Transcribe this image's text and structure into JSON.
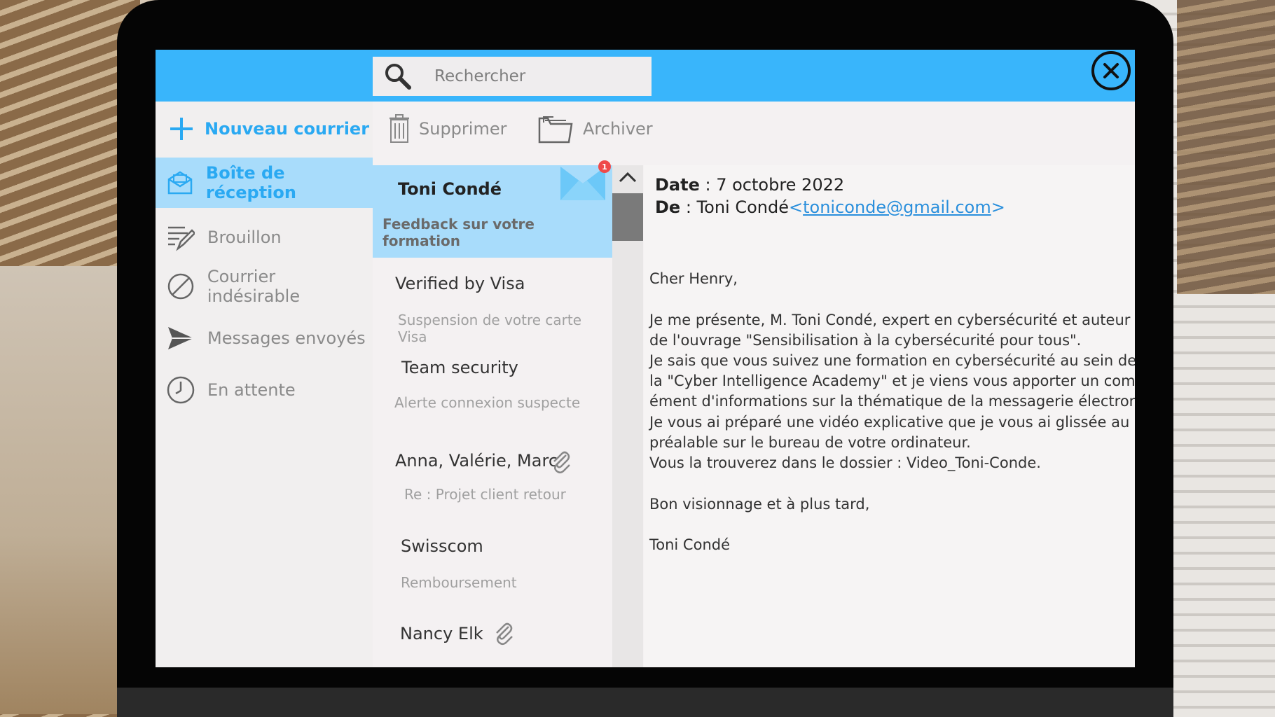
{
  "search": {
    "placeholder": "Rechercher"
  },
  "sidebar": {
    "new_mail": "Nouveau courrier",
    "items": [
      {
        "label": "Boîte de réception",
        "icon": "inbox-icon"
      },
      {
        "label": "Brouillon",
        "icon": "draft-icon"
      },
      {
        "label": "Courrier indésirable",
        "icon": "spam-icon"
      },
      {
        "label": "Messages envoyés",
        "icon": "send-icon"
      },
      {
        "label": "En attente",
        "icon": "clock-icon"
      }
    ]
  },
  "toolbar": {
    "delete_label": "Supprimer",
    "archive_label": "Archiver"
  },
  "mail_list": [
    {
      "sender": "Toni Condé",
      "subject": "Feedback sur votre formation",
      "unread_count": "1"
    },
    {
      "sender": "Verified by Visa",
      "subject": "Suspension de votre carte Visa"
    },
    {
      "sender": "Team security",
      "subject": "Alerte connexion suspecte"
    },
    {
      "sender": "Anna, Valérie, Marc",
      "subject": "Re : Projet client retour",
      "attachment": true
    },
    {
      "sender": "Swisscom",
      "subject": "Remboursement"
    },
    {
      "sender": "Nancy Elk",
      "subject": "",
      "attachment": true
    }
  ],
  "message": {
    "date_label": "Date",
    "date_value": " : 7 octobre 2022",
    "from_label": "De",
    "from_name": " : Toni Condé",
    "from_email": "toniconde@gmail.com",
    "lines": [
      "Cher Henry,",
      "Je me présente, M. Toni Condé, expert en cybersécurité et auteur",
      "de l'ouvrage \"Sensibilisation à la cybersécurité pour tous\".",
      "Je sais que vous suivez une formation en cybersécurité au sein de",
      "la \"Cyber Intelligence Academy\" et je viens vous apporter un compl-",
      "ément d'informations sur la thématique de la messagerie électronique.",
      "Je vous ai préparé une vidéo explicative que je vous ai glissée au",
      "préalable sur le bureau de votre ordinateur.",
      "Vous la trouverez dans le dossier : Video_Toni-Conde.",
      "Bon visionnage et à plus tard,",
      "Toni Condé"
    ]
  },
  "colors": {
    "accent": "#39b5fb",
    "selected": "#a8dcfb",
    "link": "#2a8fdc",
    "badge": "#ef4a4a"
  }
}
